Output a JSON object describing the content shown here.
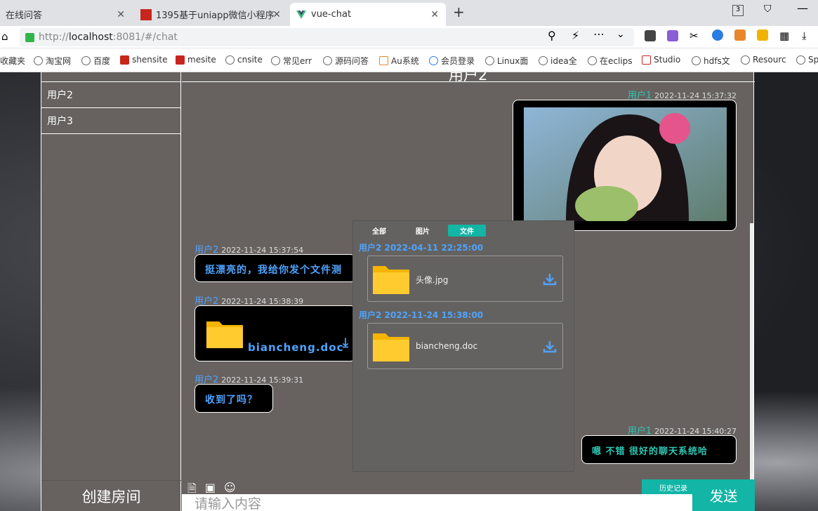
{
  "browser": {
    "tabs": [
      {
        "label": "在线问答"
      },
      {
        "label": "1395基于uniapp微信小程序"
      },
      {
        "label": "vue-chat"
      }
    ],
    "tab_count": "3",
    "url_prefix": "http://",
    "url_host": "localhost",
    "url_rest": ":8081/#/chat",
    "bookmarks": [
      "收藏夹",
      "淘宝网",
      "百度",
      "shensite",
      "mesite",
      "cnsite",
      "常见err",
      "源码问答",
      "Au系统",
      "会员登录",
      "Linux面",
      "idea全",
      "在eclips",
      "Studio",
      "hdfs文",
      "Resourc",
      "Sp"
    ]
  },
  "sidebar": {
    "users": [
      "用户2",
      "用户3"
    ],
    "create_label": "创建房间"
  },
  "header": {
    "title": "用户2"
  },
  "messages": [
    {
      "name": "用户1",
      "time": "2022-11-24 15:37:32"
    },
    {
      "name": "用户2",
      "time": "2022-11-24 15:37:54",
      "text": "挺漂亮的，我给你发个文件测"
    },
    {
      "name": "用户2",
      "time": "2022-11-24 15:38:39",
      "file": "biancheng.doc"
    },
    {
      "name": "用户2",
      "time": "2022-11-24 15:39:31",
      "text": "收到了吗？"
    },
    {
      "name": "用户1",
      "time": "2022-11-24 15:40:27",
      "text": "嗯 不错 很好的聊天系统哈"
    }
  ],
  "history_panel": {
    "tabs": [
      "全部",
      "图片",
      "文件"
    ],
    "active_tab": "文件",
    "entries": [
      {
        "header": "用户2 2022-04-11 22:25:00",
        "file": "头像.jpg"
      },
      {
        "header": "用户2 2022-11-24 15:38:00",
        "file": "biancheng.doc"
      }
    ]
  },
  "composer": {
    "placeholder": "请输入内容",
    "history_label": "历史记录",
    "send_label": "发送"
  },
  "colors": {
    "accent": "#12b5a6",
    "user_blue": "#4fa3ff",
    "user_teal": "#2fc6b4",
    "chat_bg": "#67625f"
  }
}
